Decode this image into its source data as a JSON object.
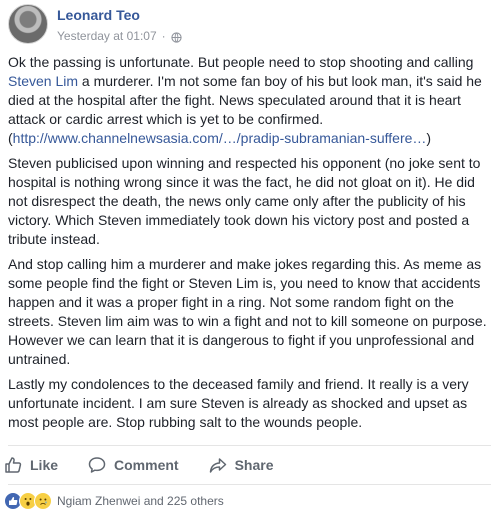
{
  "post": {
    "author": "Leonard Teo",
    "timestamp": "Yesterday at 01:07",
    "separator": "·",
    "paragraphs": {
      "p1_a": "Ok the passing is unfortunate. But people need to stop shooting and calling ",
      "p1_link": "Steven Lim",
      "p1_b": " a murderer. I'm not some fan boy of his but look man, it's said he died at the hospital after the fight. News speculated around that it is heart attack or cardic arrest which is yet to be confirmed. (",
      "p1_url": "http://www.channelnewsasia.com/…/pradip-subramanian-suffere…",
      "p1_c": ")",
      "p2": "Steven publicised upon winning and respected his opponent (no joke sent to hospital is nothing wrong since it was the fact, he did not gloat on it). He did not disrespect the death, the news only came only after the publicity of his victory. Which Steven immediately took down his victory post and posted a tribute instead.",
      "p3": "And stop calling him a murderer and make jokes regarding this. As meme as some people find the fight or Steven Lim is, you need to know that accidents happen and it was a proper fight in a ring. Not some random fight on the streets. Steven lim aim was to win a fight and not to kill someone on purpose. However we can learn that it is dangerous to fight if you unprofessional and untrained.",
      "p4": "Lastly my condolences to the deceased family and friend. It really is a very unfortunate incident. I am sure Steven is already as shocked and upset as most people are. Stop rubbing salt to the wounds people."
    }
  },
  "actions": {
    "like": "Like",
    "comment": "Comment",
    "share": "Share"
  },
  "reactions": {
    "icons": [
      "like-icon",
      "wow-icon",
      "sad-icon"
    ],
    "summary": "Ngiam Zhenwei and 225 others"
  }
}
